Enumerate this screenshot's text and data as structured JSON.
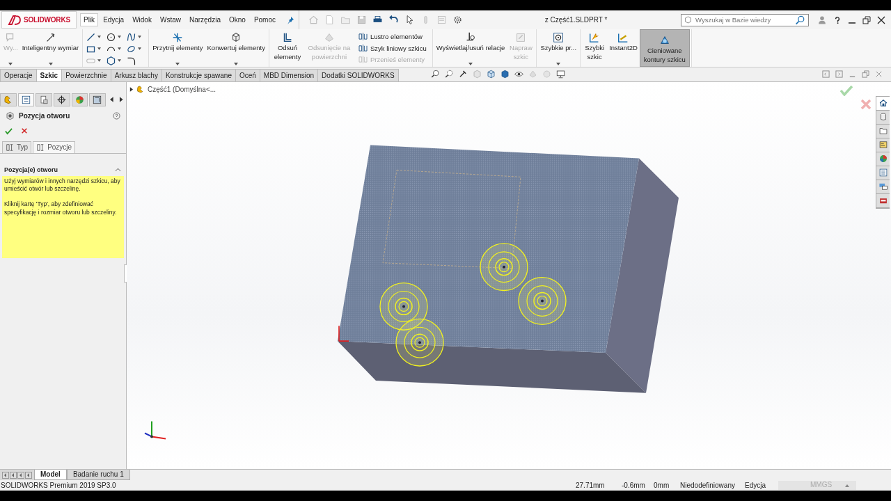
{
  "app": {
    "logo": "SOLIDWORKS"
  },
  "menu": [
    {
      "label": "Plik",
      "selected": true
    },
    {
      "label": "Edycja",
      "selected": false
    },
    {
      "label": "Widok",
      "selected": false
    },
    {
      "label": "Wstaw",
      "selected": false
    },
    {
      "label": "Narzędzia",
      "selected": false
    },
    {
      "label": "Okno",
      "selected": false
    },
    {
      "label": "Pomoc",
      "selected": false
    }
  ],
  "document_title": "z Część1.SLDPRT *",
  "search": {
    "placeholder": "Wyszukaj w Bazie wiedzy"
  },
  "ribbon": [
    {
      "items": [
        {
          "kind": "large",
          "label": "Wy...",
          "disabled": true,
          "dropdown": true
        },
        {
          "kind": "large",
          "label": "Inteligentny wymiar",
          "disabled": false,
          "dropdown": true
        }
      ]
    },
    {
      "items": [
        {
          "kind": "tools"
        }
      ]
    },
    {
      "items": [
        {
          "kind": "large",
          "label": "Przytnij elementy",
          "disabled": false,
          "dropdown": true
        },
        {
          "kind": "large",
          "label": "Konwertuj elementy",
          "disabled": false,
          "dropdown": true
        }
      ]
    },
    {
      "items": [
        {
          "kind": "large",
          "label": "Odsuń elementy",
          "disabled": false,
          "dropdown": false
        },
        {
          "kind": "large",
          "label": "Odsunięcie na powierzchni",
          "disabled": true,
          "dropdown": false
        },
        {
          "kind": "list",
          "entries": [
            {
              "label": "Lustro elementów",
              "disabled": false
            },
            {
              "label": "Szyk liniowy szkicu",
              "disabled": false
            },
            {
              "label": "Przenieś elementy",
              "disabled": true
            }
          ]
        }
      ]
    },
    {
      "items": [
        {
          "kind": "large",
          "label": "Wyświetlaj/usuń relacje",
          "disabled": false,
          "dropdown": true
        },
        {
          "kind": "large",
          "label": "Napraw szkic",
          "disabled": true,
          "dropdown": false
        }
      ]
    },
    {
      "items": [
        {
          "kind": "large",
          "label": "Szybkie pr...",
          "disabled": false,
          "dropdown": true
        }
      ]
    },
    {
      "items": [
        {
          "kind": "large",
          "label": "Szybki szkic",
          "disabled": false,
          "dropdown": false
        },
        {
          "kind": "large",
          "label": "Instant2D",
          "disabled": false,
          "dropdown": false
        },
        {
          "kind": "large",
          "label": "Cieniowane kontury szkicu",
          "disabled": false,
          "dropdown": false,
          "selected": true
        }
      ]
    }
  ],
  "command_tabs": [
    {
      "label": "Operacje",
      "selected": false
    },
    {
      "label": "Szkic",
      "selected": true
    },
    {
      "label": "Powierzchnie",
      "selected": false
    },
    {
      "label": "Arkusz blachy",
      "selected": false
    },
    {
      "label": "Konstrukcje spawane",
      "selected": false
    },
    {
      "label": "Oceń",
      "selected": false
    },
    {
      "label": "MBD Dimension",
      "selected": false
    },
    {
      "label": "Dodatki SOLIDWORKS",
      "selected": false
    }
  ],
  "property_manager": {
    "title": "Pozycja otworu",
    "tabs": [
      {
        "label": "Typ",
        "selected": false
      },
      {
        "label": "Pozycje",
        "selected": true
      }
    ],
    "section": {
      "title": "Pozycja(e) otworu",
      "expanded": true,
      "paragraphs": [
        "Użyj wymiarów i innych narzędzi szkicu, aby umieścić otwór lub szczelinę.",
        "Kliknij kartę 'Typ', aby zdefiniować specyfikację i rozmiar otworu lub szczeliny."
      ]
    }
  },
  "tree": {
    "label": "Część1  (Domyślna<..."
  },
  "bottom_tabs": [
    {
      "label": "Model",
      "selected": true
    },
    {
      "label": "Badanie ruchu 1",
      "selected": false
    }
  ],
  "status_bar": {
    "product": "SOLIDWORKS Premium 2019 SP3.0",
    "fields": [
      {
        "text": "27.71mm",
        "disabled": false
      },
      {
        "text": "-0.6mm",
        "disabled": false
      },
      {
        "text": "0mm",
        "disabled": false
      },
      {
        "text": "Niedodefiniowany",
        "disabled": false
      },
      {
        "text": "Edycja",
        "disabled": false
      },
      {
        "text": "MMGS",
        "disabled": true
      }
    ]
  }
}
